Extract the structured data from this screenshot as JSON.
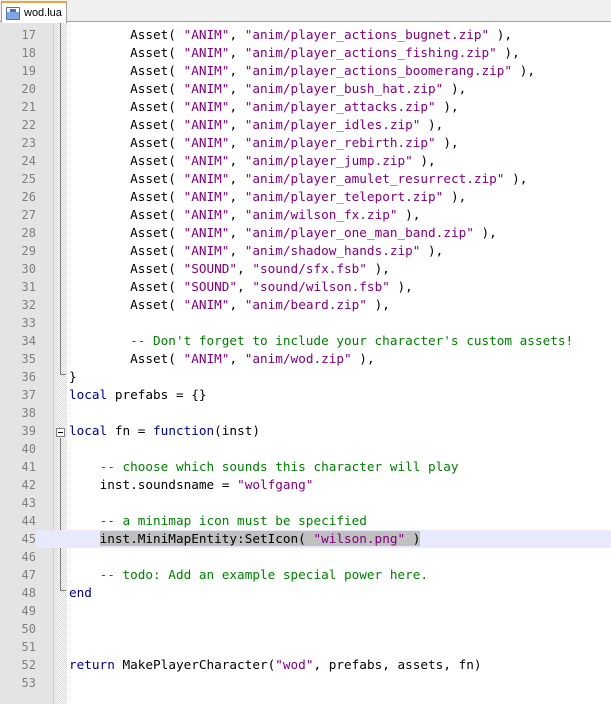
{
  "tab": {
    "filename": "wod.lua",
    "icon": "save-icon"
  },
  "lines": [
    {
      "n": "17",
      "segs": [
        {
          "t": "        ",
          "c": ""
        },
        {
          "t": "Asset( ",
          "c": ""
        },
        {
          "t": "\"ANIM\"",
          "c": "str"
        },
        {
          "t": ", ",
          "c": ""
        },
        {
          "t": "\"anim/player_actions_bugnet.zip\"",
          "c": "str"
        },
        {
          "t": " ),",
          "c": ""
        }
      ]
    },
    {
      "n": "18",
      "segs": [
        {
          "t": "        ",
          "c": ""
        },
        {
          "t": "Asset( ",
          "c": ""
        },
        {
          "t": "\"ANIM\"",
          "c": "str"
        },
        {
          "t": ", ",
          "c": ""
        },
        {
          "t": "\"anim/player_actions_fishing.zip\"",
          "c": "str"
        },
        {
          "t": " ),",
          "c": ""
        }
      ]
    },
    {
      "n": "19",
      "segs": [
        {
          "t": "        ",
          "c": ""
        },
        {
          "t": "Asset( ",
          "c": ""
        },
        {
          "t": "\"ANIM\"",
          "c": "str"
        },
        {
          "t": ", ",
          "c": ""
        },
        {
          "t": "\"anim/player_actions_boomerang.zip\"",
          "c": "str"
        },
        {
          "t": " ),",
          "c": ""
        }
      ]
    },
    {
      "n": "20",
      "segs": [
        {
          "t": "        ",
          "c": ""
        },
        {
          "t": "Asset( ",
          "c": ""
        },
        {
          "t": "\"ANIM\"",
          "c": "str"
        },
        {
          "t": ", ",
          "c": ""
        },
        {
          "t": "\"anim/player_bush_hat.zip\"",
          "c": "str"
        },
        {
          "t": " ),",
          "c": ""
        }
      ]
    },
    {
      "n": "21",
      "segs": [
        {
          "t": "        ",
          "c": ""
        },
        {
          "t": "Asset( ",
          "c": ""
        },
        {
          "t": "\"ANIM\"",
          "c": "str"
        },
        {
          "t": ", ",
          "c": ""
        },
        {
          "t": "\"anim/player_attacks.zip\"",
          "c": "str"
        },
        {
          "t": " ),",
          "c": ""
        }
      ]
    },
    {
      "n": "22",
      "segs": [
        {
          "t": "        ",
          "c": ""
        },
        {
          "t": "Asset( ",
          "c": ""
        },
        {
          "t": "\"ANIM\"",
          "c": "str"
        },
        {
          "t": ", ",
          "c": ""
        },
        {
          "t": "\"anim/player_idles.zip\"",
          "c": "str"
        },
        {
          "t": " ),",
          "c": ""
        }
      ]
    },
    {
      "n": "23",
      "segs": [
        {
          "t": "        ",
          "c": ""
        },
        {
          "t": "Asset( ",
          "c": ""
        },
        {
          "t": "\"ANIM\"",
          "c": "str"
        },
        {
          "t": ", ",
          "c": ""
        },
        {
          "t": "\"anim/player_rebirth.zip\"",
          "c": "str"
        },
        {
          "t": " ),",
          "c": ""
        }
      ]
    },
    {
      "n": "24",
      "segs": [
        {
          "t": "        ",
          "c": ""
        },
        {
          "t": "Asset( ",
          "c": ""
        },
        {
          "t": "\"ANIM\"",
          "c": "str"
        },
        {
          "t": ", ",
          "c": ""
        },
        {
          "t": "\"anim/player_jump.zip\"",
          "c": "str"
        },
        {
          "t": " ),",
          "c": ""
        }
      ]
    },
    {
      "n": "25",
      "segs": [
        {
          "t": "        ",
          "c": ""
        },
        {
          "t": "Asset( ",
          "c": ""
        },
        {
          "t": "\"ANIM\"",
          "c": "str"
        },
        {
          "t": ", ",
          "c": ""
        },
        {
          "t": "\"anim/player_amulet_resurrect.zip\"",
          "c": "str"
        },
        {
          "t": " ),",
          "c": ""
        }
      ]
    },
    {
      "n": "26",
      "segs": [
        {
          "t": "        ",
          "c": ""
        },
        {
          "t": "Asset( ",
          "c": ""
        },
        {
          "t": "\"ANIM\"",
          "c": "str"
        },
        {
          "t": ", ",
          "c": ""
        },
        {
          "t": "\"anim/player_teleport.zip\"",
          "c": "str"
        },
        {
          "t": " ),",
          "c": ""
        }
      ]
    },
    {
      "n": "27",
      "segs": [
        {
          "t": "        ",
          "c": ""
        },
        {
          "t": "Asset( ",
          "c": ""
        },
        {
          "t": "\"ANIM\"",
          "c": "str"
        },
        {
          "t": ", ",
          "c": ""
        },
        {
          "t": "\"anim/wilson_fx.zip\"",
          "c": "str"
        },
        {
          "t": " ),",
          "c": ""
        }
      ]
    },
    {
      "n": "28",
      "segs": [
        {
          "t": "        ",
          "c": ""
        },
        {
          "t": "Asset( ",
          "c": ""
        },
        {
          "t": "\"ANIM\"",
          "c": "str"
        },
        {
          "t": ", ",
          "c": ""
        },
        {
          "t": "\"anim/player_one_man_band.zip\"",
          "c": "str"
        },
        {
          "t": " ),",
          "c": ""
        }
      ]
    },
    {
      "n": "29",
      "segs": [
        {
          "t": "        ",
          "c": ""
        },
        {
          "t": "Asset( ",
          "c": ""
        },
        {
          "t": "\"ANIM\"",
          "c": "str"
        },
        {
          "t": ", ",
          "c": ""
        },
        {
          "t": "\"anim/shadow_hands.zip\"",
          "c": "str"
        },
        {
          "t": " ),",
          "c": ""
        }
      ]
    },
    {
      "n": "30",
      "segs": [
        {
          "t": "        ",
          "c": ""
        },
        {
          "t": "Asset( ",
          "c": ""
        },
        {
          "t": "\"SOUND\"",
          "c": "str"
        },
        {
          "t": ", ",
          "c": ""
        },
        {
          "t": "\"sound/sfx.fsb\"",
          "c": "str"
        },
        {
          "t": " ),",
          "c": ""
        }
      ]
    },
    {
      "n": "31",
      "segs": [
        {
          "t": "        ",
          "c": ""
        },
        {
          "t": "Asset( ",
          "c": ""
        },
        {
          "t": "\"SOUND\"",
          "c": "str"
        },
        {
          "t": ", ",
          "c": ""
        },
        {
          "t": "\"sound/wilson.fsb\"",
          "c": "str"
        },
        {
          "t": " ),",
          "c": ""
        }
      ]
    },
    {
      "n": "32",
      "segs": [
        {
          "t": "        ",
          "c": ""
        },
        {
          "t": "Asset( ",
          "c": ""
        },
        {
          "t": "\"ANIM\"",
          "c": "str"
        },
        {
          "t": ", ",
          "c": ""
        },
        {
          "t": "\"anim/beard.zip\"",
          "c": "str"
        },
        {
          "t": " ),",
          "c": ""
        }
      ]
    },
    {
      "n": "33",
      "segs": []
    },
    {
      "n": "34",
      "segs": [
        {
          "t": "        ",
          "c": ""
        },
        {
          "t": "-- Don't forget to include your character's custom assets!",
          "c": "cmt"
        }
      ]
    },
    {
      "n": "35",
      "segs": [
        {
          "t": "        ",
          "c": ""
        },
        {
          "t": "Asset( ",
          "c": ""
        },
        {
          "t": "\"ANIM\"",
          "c": "str"
        },
        {
          "t": ", ",
          "c": ""
        },
        {
          "t": "\"anim/wod.zip\"",
          "c": "str"
        },
        {
          "t": " ),",
          "c": ""
        }
      ]
    },
    {
      "n": "36",
      "segs": [
        {
          "t": "}",
          "c": ""
        }
      ]
    },
    {
      "n": "37",
      "segs": [
        {
          "t": "local",
          "c": "kw"
        },
        {
          "t": " prefabs = {}",
          "c": ""
        }
      ]
    },
    {
      "n": "38",
      "segs": []
    },
    {
      "n": "39",
      "segs": [
        {
          "t": "local",
          "c": "kw"
        },
        {
          "t": " fn = ",
          "c": ""
        },
        {
          "t": "function",
          "c": "kw"
        },
        {
          "t": "(inst)",
          "c": ""
        }
      ]
    },
    {
      "n": "40",
      "segs": []
    },
    {
      "n": "41",
      "segs": [
        {
          "t": "    ",
          "c": ""
        },
        {
          "t": "-- choose which sounds this character will play",
          "c": "cmt"
        }
      ]
    },
    {
      "n": "42",
      "segs": [
        {
          "t": "    ",
          "c": ""
        },
        {
          "t": "inst.soundsname = ",
          "c": ""
        },
        {
          "t": "\"wolfgang\"",
          "c": "str"
        }
      ]
    },
    {
      "n": "43",
      "segs": []
    },
    {
      "n": "44",
      "segs": [
        {
          "t": "    ",
          "c": ""
        },
        {
          "t": "-- a minimap icon must be specified",
          "c": "cmt"
        }
      ]
    },
    {
      "n": "45",
      "current": true,
      "segs": [
        {
          "t": "    ",
          "c": ""
        },
        {
          "t": "inst.MiniMapEntity:SetIcon( ",
          "c": "sel"
        },
        {
          "t": "\"wilson.png\"",
          "c": "sel str"
        },
        {
          "t": " )",
          "c": "sel"
        }
      ]
    },
    {
      "n": "46",
      "segs": []
    },
    {
      "n": "47",
      "segs": [
        {
          "t": "    ",
          "c": ""
        },
        {
          "t": "-- todo: Add an example special power here.",
          "c": "cmt"
        }
      ]
    },
    {
      "n": "48",
      "segs": [
        {
          "t": "end",
          "c": "kw"
        }
      ]
    },
    {
      "n": "49",
      "segs": []
    },
    {
      "n": "50",
      "segs": []
    },
    {
      "n": "51",
      "segs": []
    },
    {
      "n": "52",
      "segs": [
        {
          "t": "return",
          "c": "kw"
        },
        {
          "t": " MakePlayerCharacter(",
          "c": ""
        },
        {
          "t": "\"wod\"",
          "c": "str"
        },
        {
          "t": ", prefabs, assets, fn)",
          "c": ""
        }
      ]
    },
    {
      "n": "53",
      "segs": []
    }
  ]
}
